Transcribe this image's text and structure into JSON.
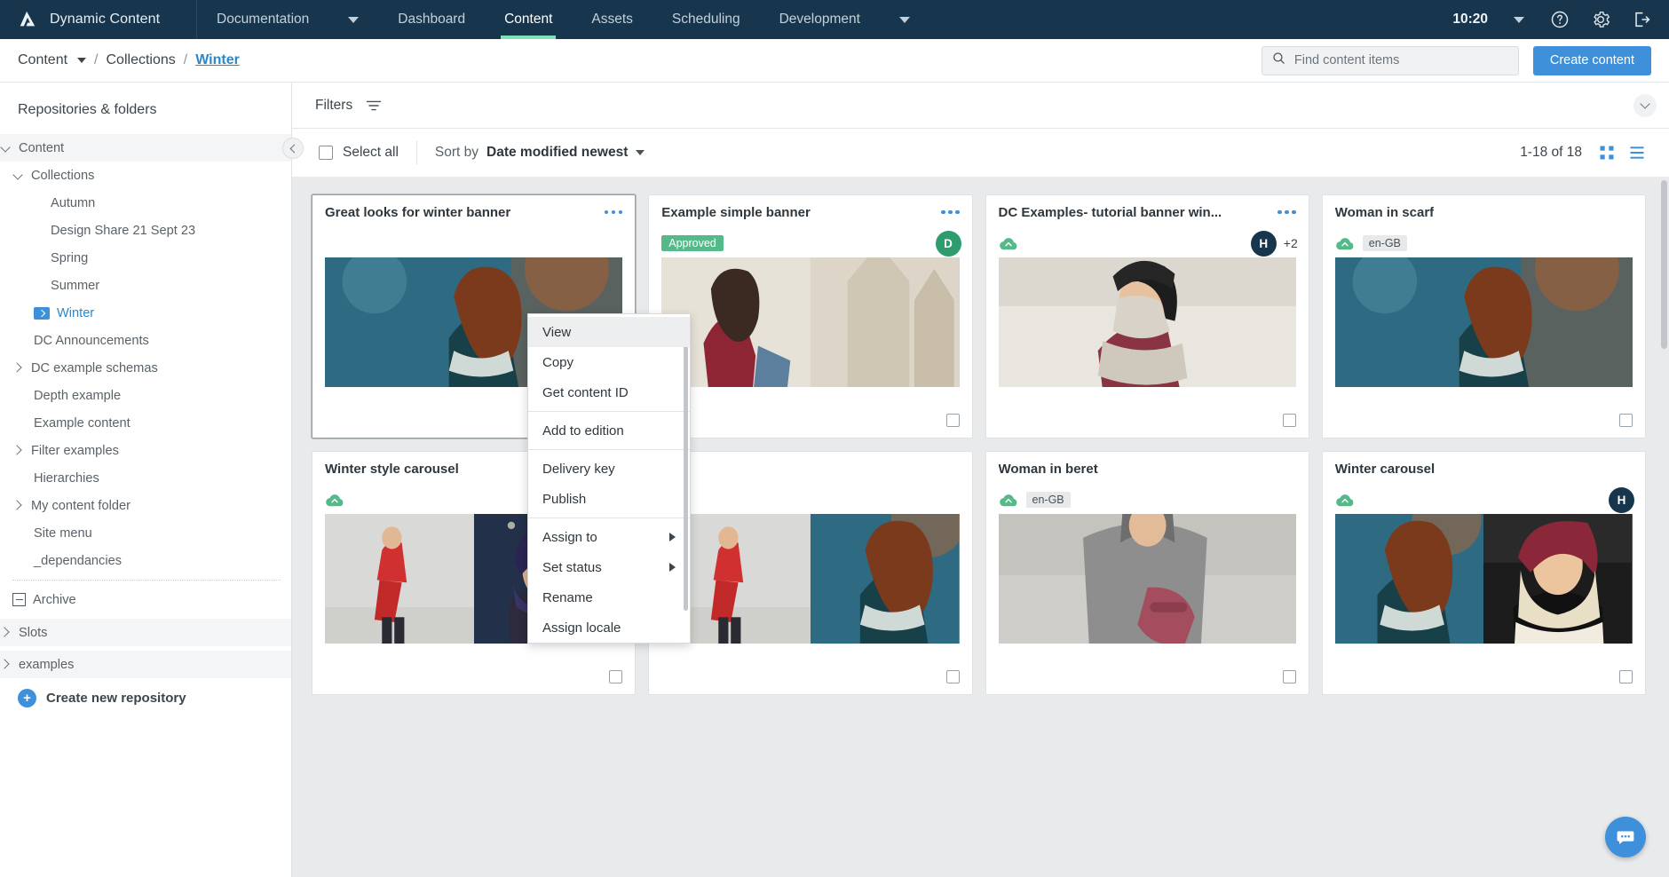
{
  "topnav": {
    "brand": "Dynamic Content",
    "logo_icon": "amplience-logo-icon",
    "dropdown_label": "Documentation",
    "dropdown_caret_icon": "chevron-down-icon",
    "items": [
      {
        "label": "Dashboard",
        "active": false
      },
      {
        "label": "Content",
        "active": true
      },
      {
        "label": "Assets",
        "active": false
      },
      {
        "label": "Scheduling",
        "active": false
      },
      {
        "label": "Development",
        "active": false
      }
    ],
    "dev_caret_icon": "chevron-down-icon",
    "clock": "10:20",
    "clock_caret_icon": "chevron-down-icon",
    "help_icon": "help-circle-icon",
    "settings_icon": "gear-icon",
    "logout_icon": "logout-icon",
    "accent": "#7ae1b9",
    "background": "#17364d"
  },
  "breadcrumb": {
    "items": [
      {
        "label": "Content",
        "link": false,
        "caret": true
      },
      {
        "label": "Collections",
        "link": false,
        "caret": false
      },
      {
        "label": "Winter",
        "link": true,
        "caret": false
      }
    ],
    "separator": "/"
  },
  "search": {
    "placeholder": "Find content items",
    "value": "",
    "icon": "search-icon"
  },
  "actions": {
    "create_content_label": "Create content",
    "primary_color": "#3e90da"
  },
  "sidebar": {
    "title": "Repositories & folders",
    "collapse_icon": "chevron-left-icon",
    "tree": [
      {
        "label": "Content",
        "indent": 0,
        "icon": "chevron-down-icon",
        "shaded": true,
        "selected": false
      },
      {
        "label": "Collections",
        "indent": 0,
        "icon": "chevron-down-icon",
        "shaded": false,
        "selected": false
      },
      {
        "label": "Autumn",
        "indent": 1,
        "icon": "none",
        "shaded": false,
        "selected": false
      },
      {
        "label": "Design Share 21 Sept 23",
        "indent": 1,
        "icon": "none",
        "shaded": false,
        "selected": false
      },
      {
        "label": "Spring",
        "indent": 1,
        "icon": "none",
        "shaded": false,
        "selected": false
      },
      {
        "label": "Summer",
        "indent": 1,
        "icon": "none",
        "shaded": false,
        "selected": false
      },
      {
        "label": "Winter",
        "indent": 0,
        "icon": "folder-selected-icon",
        "shaded": false,
        "selected": true
      },
      {
        "label": "DC Announcements",
        "indent": 0,
        "icon": "none",
        "shaded": false,
        "selected": false
      },
      {
        "label": "DC example schemas",
        "indent": 0,
        "icon": "chevron-right-icon",
        "shaded": false,
        "selected": false
      },
      {
        "label": "Depth example",
        "indent": 0,
        "icon": "none",
        "shaded": false,
        "selected": false
      },
      {
        "label": "Example content",
        "indent": 0,
        "icon": "none",
        "shaded": false,
        "selected": false
      },
      {
        "label": "Filter examples",
        "indent": 0,
        "icon": "chevron-right-icon",
        "shaded": false,
        "selected": false
      },
      {
        "label": "Hierarchies",
        "indent": 0,
        "icon": "none",
        "shaded": false,
        "selected": false
      },
      {
        "label": "My content folder",
        "indent": 0,
        "icon": "chevron-right-icon",
        "shaded": false,
        "selected": false
      },
      {
        "label": "Site menu",
        "indent": 0,
        "icon": "none",
        "shaded": false,
        "selected": false
      },
      {
        "label": "_dependancies",
        "indent": 0,
        "icon": "none",
        "shaded": false,
        "selected": false
      }
    ],
    "archive": {
      "label": "Archive",
      "icon": "archive-box-icon"
    },
    "repos": [
      {
        "label": "Slots",
        "icon": "chevron-right-icon",
        "shaded": true
      },
      {
        "label": "examples",
        "icon": "chevron-right-icon",
        "shaded": true
      }
    ],
    "create_repo": {
      "label": "Create new repository",
      "icon": "plus-circle-icon"
    }
  },
  "filterbar": {
    "label": "Filters",
    "filter_icon": "filter-icon",
    "expand_icon": "chevron-down-icon"
  },
  "toolbar": {
    "select_all_label": "Select all",
    "sort_by_label": "Sort by",
    "sort_value": "Date modified newest",
    "sort_caret_icon": "chevron-down-icon",
    "pagination": "1-18 of 18",
    "grid_view_icon": "grid-view-icon",
    "list_view_icon": "list-view-icon"
  },
  "cards": [
    {
      "title": "Great looks for winter banner",
      "menu_icon": "more-options-icon",
      "highlight": true,
      "status_chip": "",
      "locale": "",
      "cloud": false,
      "avatars": [],
      "extra": "",
      "thumb": "woman-red-hair-scarf",
      "split": false
    },
    {
      "title": "Example simple banner",
      "menu_icon": "more-options-icon",
      "highlight": false,
      "status_chip": "Approved",
      "locale": "",
      "cloud": false,
      "avatars": [
        {
          "initial": "D",
          "color": "green"
        }
      ],
      "extra": "",
      "thumb": "shopper-cathedral",
      "split": false
    },
    {
      "title": "DC Examples- tutorial banner win...",
      "menu_icon": "more-options-icon",
      "highlight": false,
      "status_chip": "",
      "locale": "",
      "cloud": true,
      "avatars": [
        {
          "initial": "H",
          "color": "navy"
        }
      ],
      "extra": "+2",
      "thumb": "woman-black-beanie",
      "split": false
    },
    {
      "title": "Woman in scarf",
      "menu_icon": "more-options-icon",
      "highlight": false,
      "status_chip": "",
      "locale": "en-GB",
      "cloud": true,
      "avatars": [],
      "extra": "",
      "thumb": "woman-red-hair-scarf",
      "split": false
    },
    {
      "title": "Winter style carousel",
      "menu_icon": "more-options-icon",
      "highlight": false,
      "status_chip": "",
      "locale": "",
      "cloud": true,
      "avatars": [],
      "extra": "",
      "thumb": "carousel-red-coat-blue-hat",
      "split": true
    },
    {
      "title": "",
      "menu_icon": "more-options-icon",
      "highlight": false,
      "status_chip": "",
      "locale": "",
      "cloud": false,
      "avatars": [],
      "extra": "",
      "thumb": "carousel-red-coat-scarf",
      "split": true
    },
    {
      "title": "Woman in beret",
      "menu_icon": "more-options-icon",
      "highlight": false,
      "status_chip": "",
      "locale": "en-GB",
      "cloud": true,
      "avatars": [],
      "extra": "",
      "thumb": "woman-grey-coat-handbag",
      "split": false
    },
    {
      "title": "Winter carousel",
      "menu_icon": "more-options-icon",
      "highlight": false,
      "status_chip": "",
      "locale": "",
      "cloud": true,
      "avatars": [
        {
          "initial": "H",
          "color": "navy"
        }
      ],
      "extra": "",
      "thumb": "carousel-scarf-beret",
      "split": true
    }
  ],
  "context_menu": {
    "items": [
      {
        "label": "View",
        "hover": true,
        "submenu": false,
        "sep_after": false
      },
      {
        "label": "Copy",
        "hover": false,
        "submenu": false,
        "sep_after": false
      },
      {
        "label": "Get content ID",
        "hover": false,
        "submenu": false,
        "sep_after": true
      },
      {
        "label": "Add to edition",
        "hover": false,
        "submenu": false,
        "sep_after": true
      },
      {
        "label": "Delivery key",
        "hover": false,
        "submenu": false,
        "sep_after": false
      },
      {
        "label": "Publish",
        "hover": false,
        "submenu": false,
        "sep_after": true
      },
      {
        "label": "Assign to",
        "hover": false,
        "submenu": true,
        "sep_after": false
      },
      {
        "label": "Set status",
        "hover": false,
        "submenu": true,
        "sep_after": false
      },
      {
        "label": "Rename",
        "hover": false,
        "submenu": false,
        "sep_after": false
      },
      {
        "label": "Assign locale",
        "hover": false,
        "submenu": false,
        "sep_after": false
      }
    ]
  },
  "chat": {
    "icon": "chat-bubble-icon"
  }
}
